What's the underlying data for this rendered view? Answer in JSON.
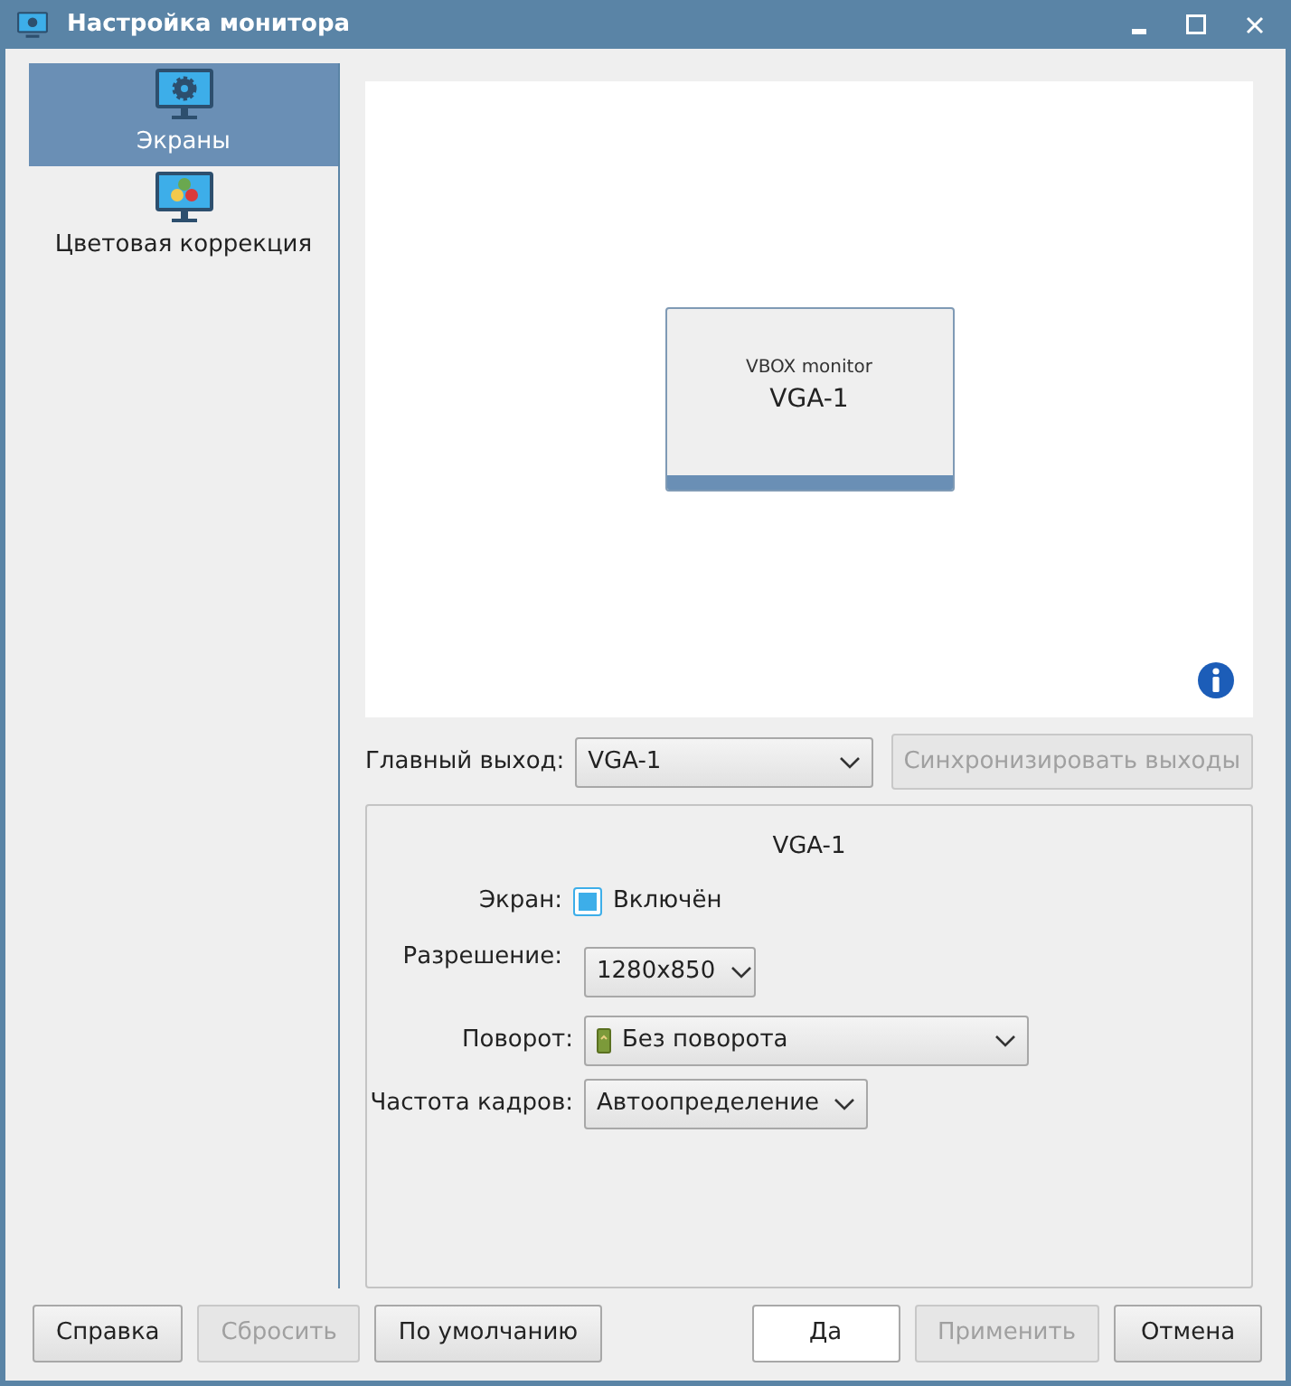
{
  "window": {
    "title": "Настройка монитора"
  },
  "sidebar": {
    "items": [
      {
        "label": "Экраны",
        "kind": "screens",
        "selected": true
      },
      {
        "label": "Цветовая коррекция",
        "kind": "color",
        "selected": false
      }
    ]
  },
  "preview": {
    "monitor": {
      "model": "VBOX monitor",
      "name": "VGA-1"
    }
  },
  "primary_output": {
    "label": "Главный выход:",
    "value": "VGA-1"
  },
  "sync_button": {
    "label": "Синхронизировать выходы",
    "disabled": true
  },
  "output_settings": {
    "title": "VGA-1",
    "screen": {
      "label": "Экран:",
      "option": "Включён",
      "checked": true
    },
    "resolution": {
      "label": "Разрешение:",
      "value": "1280x850"
    },
    "rotation": {
      "label": "Поворот:",
      "value": "Без поворота"
    },
    "refresh_rate": {
      "label": "Частота кадров:",
      "value": "Автоопределение"
    }
  },
  "left_buttons": [
    {
      "label": "Справка",
      "disabled": false,
      "default": false
    },
    {
      "label": "Сбросить",
      "disabled": true,
      "default": false
    },
    {
      "label": "По умолчанию",
      "disabled": false,
      "default": false
    }
  ],
  "right_buttons": [
    {
      "label": "Да",
      "disabled": false,
      "default": true
    },
    {
      "label": "Применить",
      "disabled": true,
      "default": false
    },
    {
      "label": "Отмена",
      "disabled": false,
      "default": false
    }
  ]
}
